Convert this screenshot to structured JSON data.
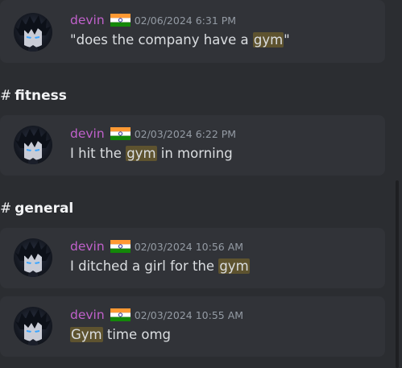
{
  "results": [
    {
      "channel": null,
      "username": "devin",
      "flag_icon": "india-flag-icon",
      "timestamp": "02/06/2024 6:31 PM",
      "parts": [
        {
          "text": "\"does the company have a ",
          "highlight": false
        },
        {
          "text": "gym",
          "highlight": true
        },
        {
          "text": "\"",
          "highlight": false
        }
      ]
    },
    {
      "channel": "fitness",
      "username": "devin",
      "flag_icon": "india-flag-icon",
      "timestamp": "02/03/2024 6:22 PM",
      "parts": [
        {
          "text": "I hit the ",
          "highlight": false
        },
        {
          "text": "gym",
          "highlight": true
        },
        {
          "text": " in morning",
          "highlight": false
        }
      ]
    },
    {
      "channel": "general",
      "username": "devin",
      "flag_icon": "india-flag-icon",
      "timestamp": "02/03/2024 10:56 AM",
      "parts": [
        {
          "text": "I ditched a girl for the ",
          "highlight": false
        },
        {
          "text": "gym",
          "highlight": true
        }
      ]
    },
    {
      "channel": null,
      "username": "devin",
      "flag_icon": "india-flag-icon",
      "timestamp": "02/03/2024 10:55 AM",
      "parts": [
        {
          "text": "Gym",
          "highlight": true
        },
        {
          "text": " time omg",
          "highlight": false
        }
      ]
    }
  ],
  "channels": {
    "fitness": "fitness",
    "general": "general",
    "hash": "#"
  },
  "colors": {
    "background": "#2b2d31",
    "card": "#313338",
    "username": "#c061cb",
    "timestamp": "#949ba4",
    "message_text": "#dbdee1",
    "highlight": "#5e532f"
  }
}
